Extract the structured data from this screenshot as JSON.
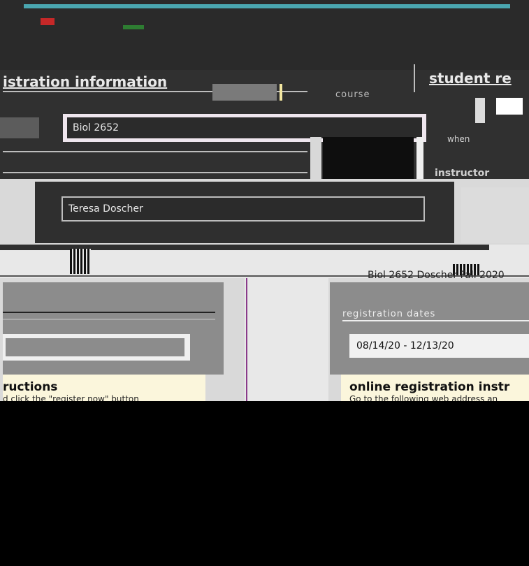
{
  "header": {
    "nav_text": "",
    "nav_right_text": ""
  },
  "registration_info": {
    "title": "istration information"
  },
  "student_record": {
    "title": "student re",
    "course_label": "course",
    "when_label": "when",
    "instructor_label": "instructor"
  },
  "course": {
    "value": "Biol 2652"
  },
  "instructor": {
    "value": "Teresa Doscher"
  },
  "course_reference": {
    "right": "Biol 2652 Doscher Fall 2020"
  },
  "registration_dates": {
    "label": "registration dates",
    "value": "08/14/20 - 12/13/20"
  },
  "instructions_left": {
    "title": "ructions",
    "body": "d click the \"register now\" button"
  },
  "instructions_right": {
    "title": "online registration instr",
    "body": "Go to the following web address an"
  },
  "colors": {
    "accent": "#4aa6b0",
    "brand": "#c62828",
    "instructions_bg": "#fbf6dc"
  }
}
